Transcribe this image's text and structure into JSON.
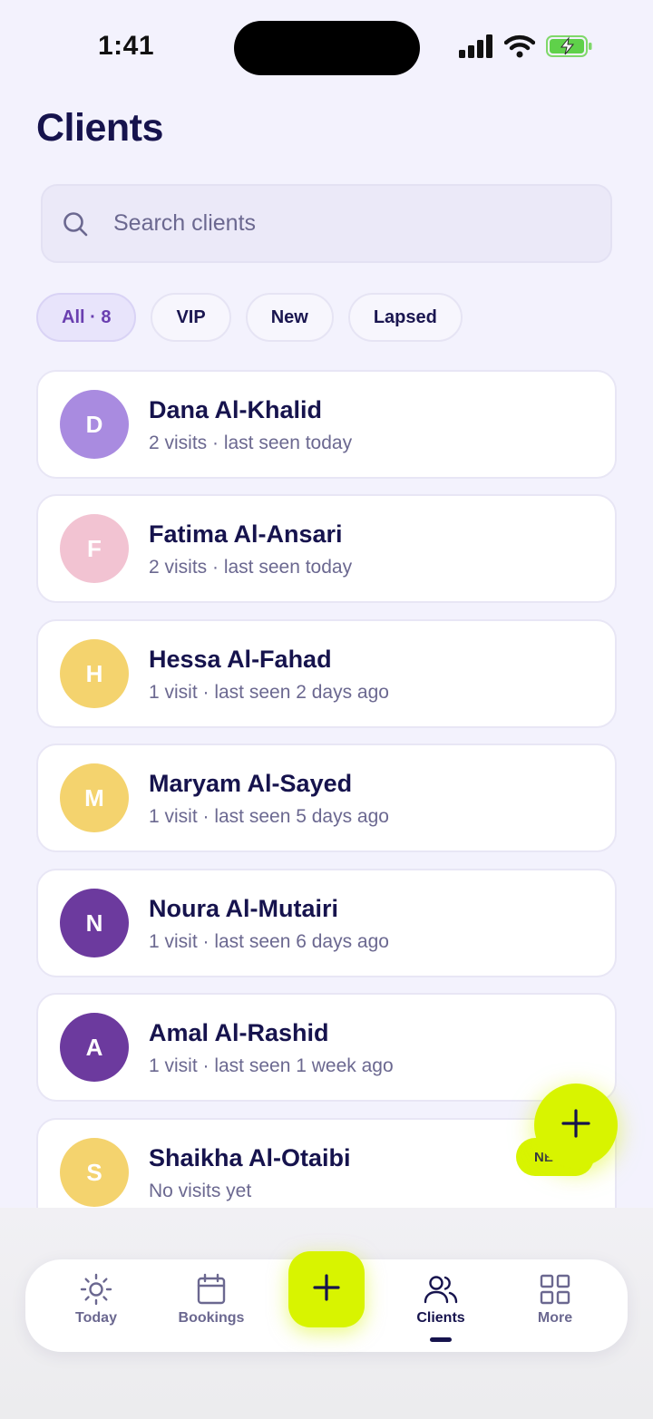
{
  "status_bar": {
    "time": "1:41"
  },
  "page": {
    "title": "Clients"
  },
  "search": {
    "placeholder": "Search clients"
  },
  "filters": [
    {
      "label": "All · 8",
      "active": true
    },
    {
      "label": "VIP",
      "active": false
    },
    {
      "label": "New",
      "active": false
    },
    {
      "label": "Lapsed",
      "active": false
    }
  ],
  "clients": [
    {
      "initial": "D",
      "name": "Dana Al-Khalid",
      "subtitle": "2 visits · last seen today",
      "color": "#a98be0"
    },
    {
      "initial": "F",
      "name": "Fatima Al-Ansari",
      "subtitle": "2 visits · last seen today",
      "color": "#f2c3d2"
    },
    {
      "initial": "H",
      "name": "Hessa Al-Fahad",
      "subtitle": "1 visit · last seen 2 days ago",
      "color": "#f4d36e"
    },
    {
      "initial": "M",
      "name": "Maryam Al-Sayed",
      "subtitle": "1 visit · last seen 5 days ago",
      "color": "#f4d36e"
    },
    {
      "initial": "N",
      "name": "Noura Al-Mutairi",
      "subtitle": "1 visit · last seen 6 days ago",
      "color": "#6c3a9e"
    },
    {
      "initial": "A",
      "name": "Amal Al-Rashid",
      "subtitle": "1 visit · last seen 1 week ago",
      "color": "#6c3a9e"
    },
    {
      "initial": "S",
      "name": "Shaikha Al-Otaibi",
      "subtitle": "No visits yet",
      "color": "#f4d36e"
    }
  ],
  "fab": {
    "label": "NE"
  },
  "tabbar": {
    "tabs": [
      {
        "label": "Today",
        "icon": "sun-icon"
      },
      {
        "label": "Bookings",
        "icon": "calendar-icon"
      },
      {
        "label": "Clients",
        "icon": "users-icon",
        "active": true
      },
      {
        "label": "More",
        "icon": "grid-icon"
      }
    ]
  },
  "colors": {
    "accent": "#d8f400",
    "primary_text": "#16134d",
    "secondary_text": "#6b6890",
    "background": "#f3f2fd"
  }
}
